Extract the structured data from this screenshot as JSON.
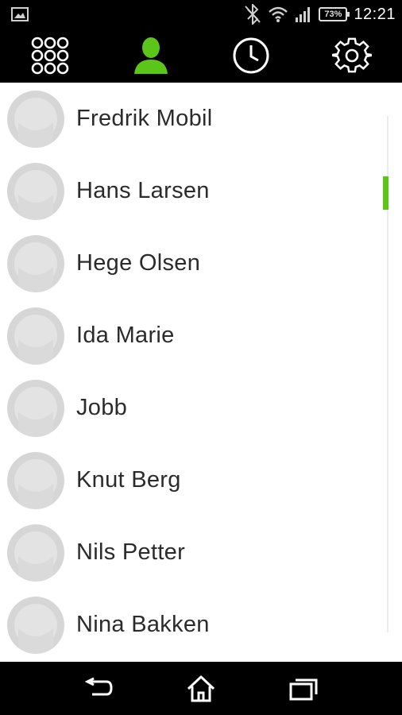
{
  "status_bar": {
    "time": "12:21",
    "battery": "73%",
    "icons": [
      "image-icon",
      "bluetooth-off-icon",
      "wifi-icon",
      "signal-icon",
      "battery-icon"
    ]
  },
  "top_nav": {
    "tabs": [
      {
        "icon": "dialpad-icon",
        "active": false
      },
      {
        "icon": "contacts-icon",
        "active": true
      },
      {
        "icon": "recents-clock-icon",
        "active": false
      },
      {
        "icon": "settings-gear-icon",
        "active": false
      }
    ],
    "active_color": "#5cc519"
  },
  "contacts": [
    {
      "name": "Fredrik Mobil"
    },
    {
      "name": "Hans Larsen"
    },
    {
      "name": "Hege Olsen"
    },
    {
      "name": "Ida Marie"
    },
    {
      "name": "Jobb"
    },
    {
      "name": "Knut Berg"
    },
    {
      "name": "Nils Petter"
    },
    {
      "name": "Nina Bakken"
    }
  ],
  "bottom_nav": {
    "icons": [
      "back-icon",
      "home-icon",
      "recent-apps-icon"
    ]
  }
}
